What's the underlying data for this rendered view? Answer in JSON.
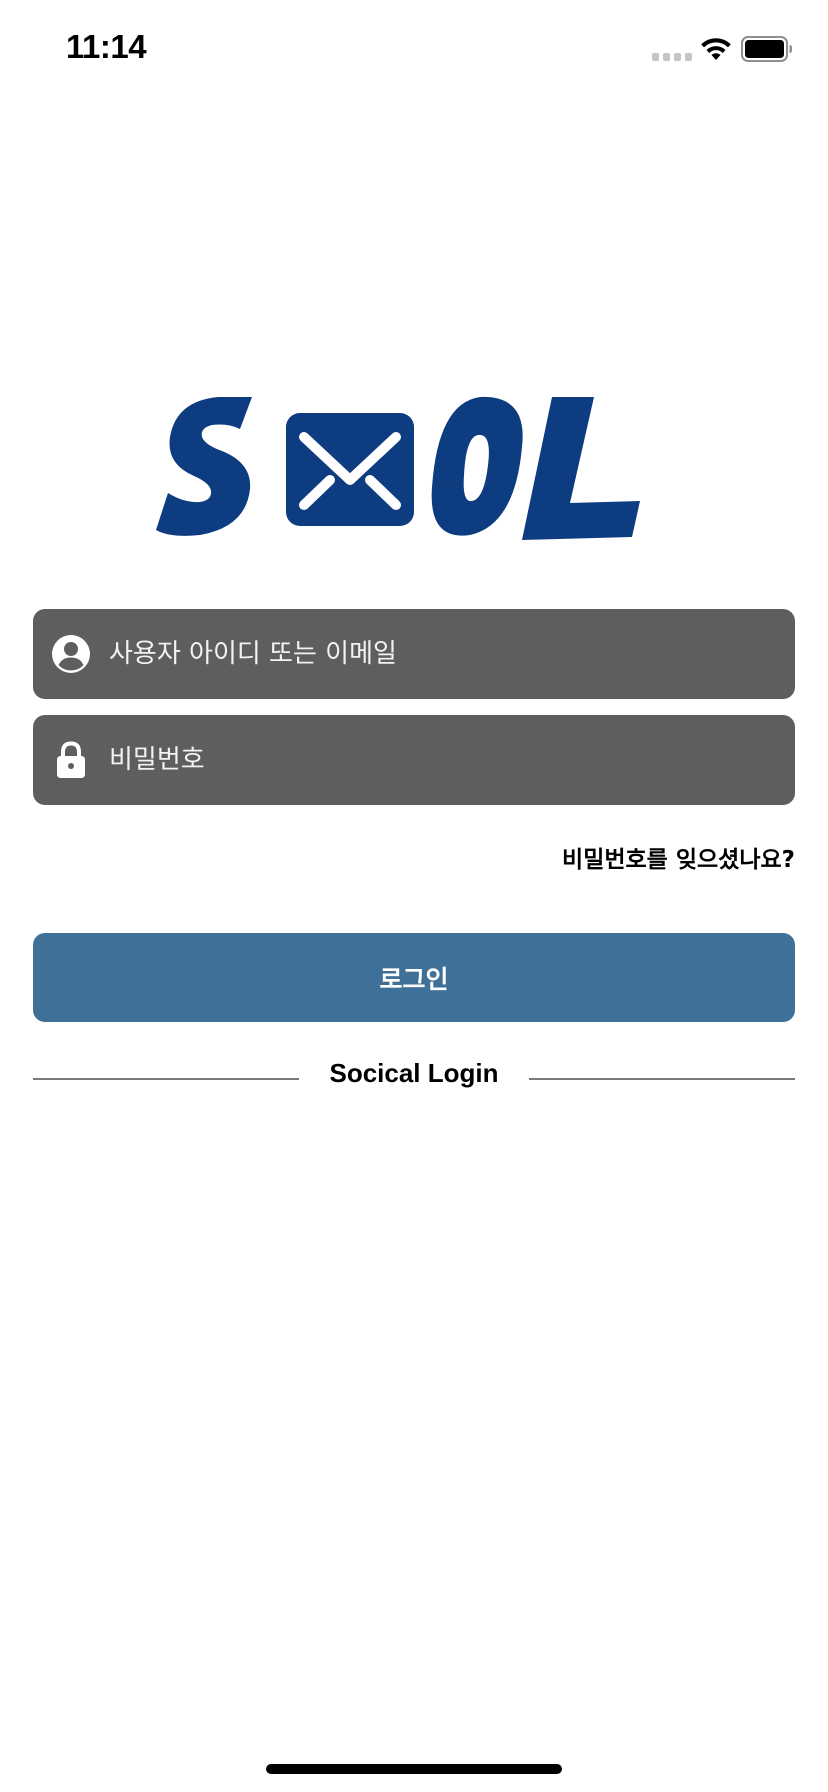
{
  "status_bar": {
    "time": "11:14",
    "icons": [
      "signal-dots-icon",
      "wifi-icon",
      "battery-icon"
    ]
  },
  "logo": {
    "text": "SMOL",
    "brand_color": "#0e3c80"
  },
  "login_form": {
    "username": {
      "icon": "user-circle-icon",
      "placeholder": "사용자 아이디 또는 이메일",
      "value": ""
    },
    "password": {
      "icon": "lock-icon",
      "placeholder": "비밀번호",
      "value": ""
    },
    "forgot_password_label": "비밀번호를 잊으셨나요?",
    "login_button_label": "로그인"
  },
  "social_login": {
    "title": "Socical Login"
  },
  "colors": {
    "field_background": "#5e5e5e",
    "login_button": "#3f7098",
    "divider": "#7a7a7a"
  }
}
